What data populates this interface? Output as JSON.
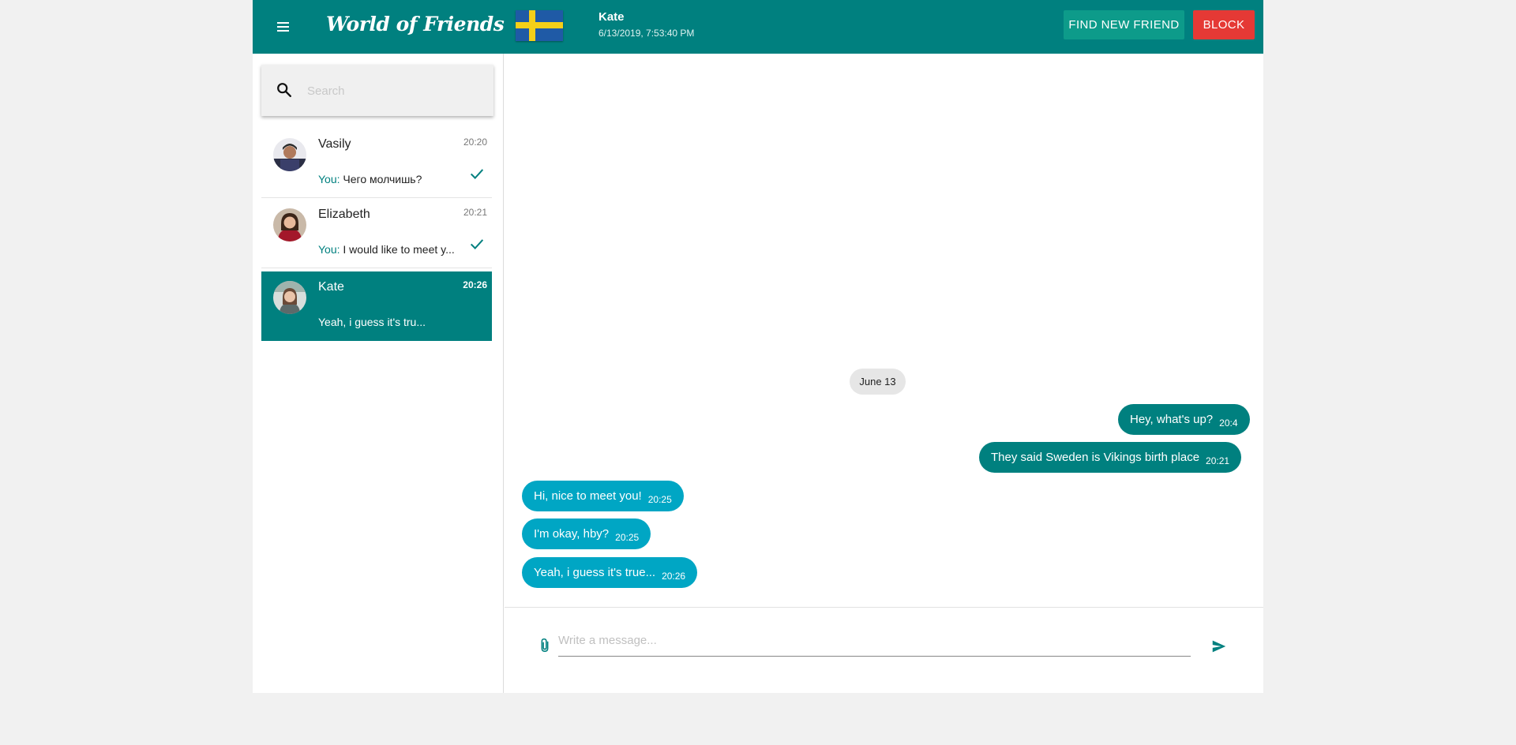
{
  "header": {
    "app_title": "World of Friends",
    "chat_name": "Kate",
    "chat_date": "6/13/2019, 7:53:40 PM",
    "find_label": "FIND NEW FRIEND",
    "block_label": "BLOCK",
    "flag_icon": "sweden-flag-icon"
  },
  "search": {
    "placeholder": "Search"
  },
  "conversations": [
    {
      "name": "Vasily",
      "time": "20:20",
      "you": "You:",
      "preview": " Чего молчишь?",
      "read": true
    },
    {
      "name": "Elizabeth",
      "time": "20:21",
      "you": "You:",
      "preview": " I would like to meet y...",
      "read": true
    },
    {
      "name": "Kate",
      "time": "20:26",
      "preview": "Yeah, i guess it's tru...",
      "active": true
    }
  ],
  "chat": {
    "date_separator": "June 13",
    "messages": [
      {
        "text": "Hey, what's up?",
        "time": "20:4",
        "direction": "out"
      },
      {
        "text": "They said Sweden is Vikings birth place",
        "time": "20:21",
        "direction": "out"
      },
      {
        "text": "Hi, nice to meet you!",
        "time": "20:25",
        "direction": "in"
      },
      {
        "text": "I'm okay, hby?",
        "time": "20:25",
        "direction": "in"
      },
      {
        "text": "Yeah, i guess it's true...",
        "time": "20:26",
        "direction": "in"
      }
    ]
  },
  "composer": {
    "placeholder": "Write a message..."
  },
  "colors": {
    "primary": "#00807f",
    "accent_button": "#0d9b8a",
    "block_button": "#e53935",
    "incoming_bubble": "#00a6c4"
  }
}
